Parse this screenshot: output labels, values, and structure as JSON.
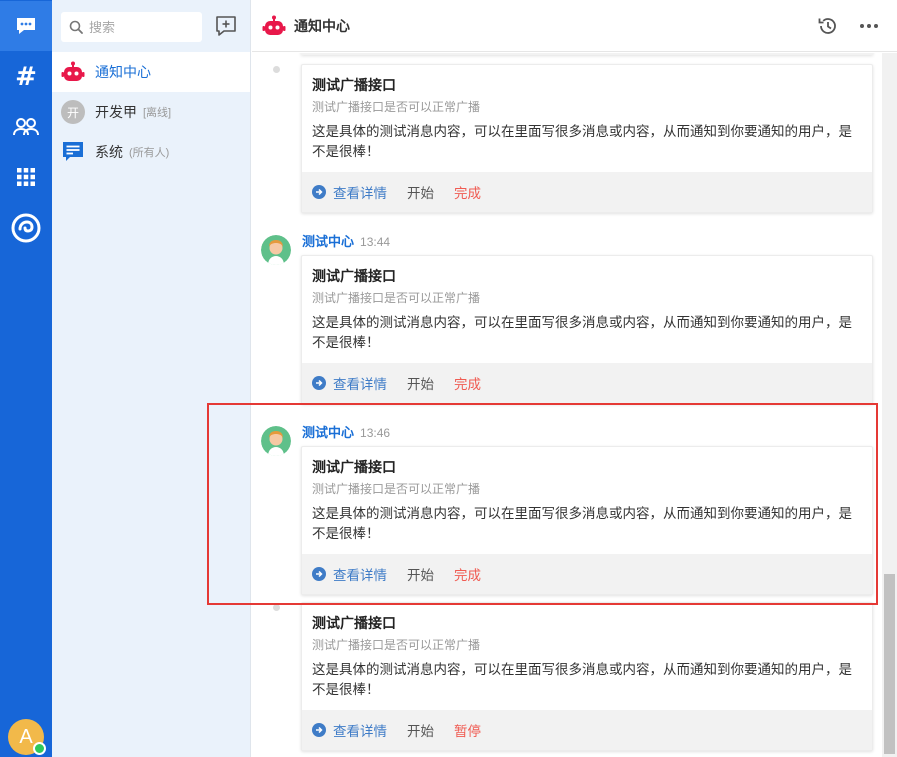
{
  "colors": {
    "rail": "#1766d8",
    "accent": "#1a6fd6",
    "done": "#f05b52",
    "highlight": "#e53935",
    "online": "#2ec95c"
  },
  "rail": {
    "items": [
      {
        "name": "chat-icon"
      },
      {
        "name": "hash-icon",
        "glyph": "#"
      },
      {
        "name": "contacts-icon"
      },
      {
        "name": "apps-grid-icon"
      },
      {
        "name": "swirl-logo-icon"
      }
    ],
    "avatar_letter": "A"
  },
  "sidebar": {
    "search_placeholder": "搜索",
    "items": [
      {
        "label": "通知中心",
        "sub": ""
      },
      {
        "label": "开发甲",
        "sub": "[离线]",
        "avatar": "开"
      },
      {
        "label": "系统",
        "sub": "(所有人)"
      }
    ]
  },
  "header": {
    "title": "通知中心"
  },
  "messages": [
    {
      "sender": "",
      "time": "",
      "title": "测试广播接口",
      "subtitle": "测试广播接口是否可以正常广播",
      "content": "这是具体的测试消息内容，可以在里面写很多消息或内容，从而通知到你要通知的用户，是不是很棒！",
      "detail": "查看详情",
      "start": "开始",
      "status": "完成"
    },
    {
      "sender": "测试中心",
      "time": "13:44",
      "title": "测试广播接口",
      "subtitle": "测试广播接口是否可以正常广播",
      "content": "这是具体的测试消息内容，可以在里面写很多消息或内容，从而通知到你要通知的用户，是不是很棒！",
      "detail": "查看详情",
      "start": "开始",
      "status": "完成"
    },
    {
      "sender": "测试中心",
      "time": "13:46",
      "title": "测试广播接口",
      "subtitle": "测试广播接口是否可以正常广播",
      "content": "这是具体的测试消息内容，可以在里面写很多消息或内容，从而通知到你要通知的用户，是不是很棒！",
      "detail": "查看详情",
      "start": "开始",
      "status": "完成"
    },
    {
      "sender": "",
      "time": "",
      "title": "测试广播接口",
      "subtitle": "测试广播接口是否可以正常广播",
      "content": "这是具体的测试消息内容，可以在里面写很多消息或内容，从而通知到你要通知的用户，是不是很棒！",
      "detail": "查看详情",
      "start": "开始",
      "status": "暂停"
    }
  ]
}
